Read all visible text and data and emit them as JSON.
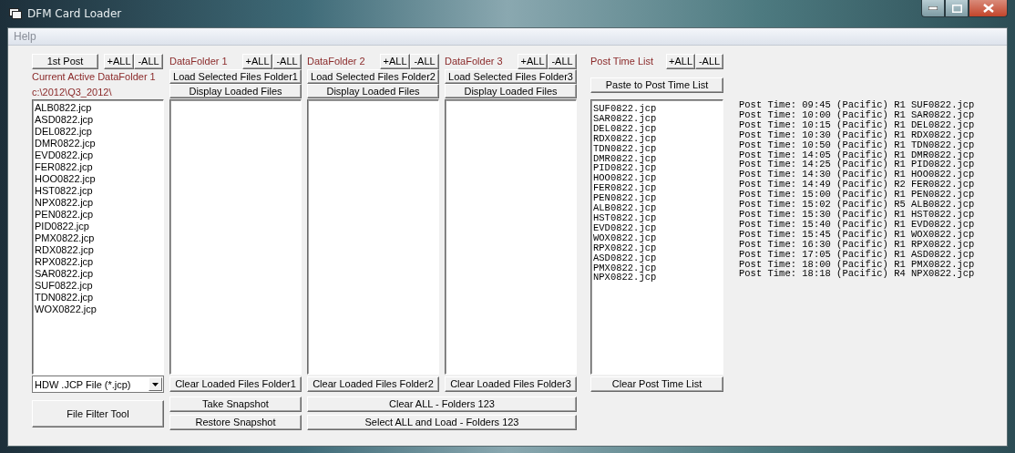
{
  "window": {
    "title": "DFM Card Loader"
  },
  "menu": [
    "Help"
  ],
  "source": {
    "post_button": "1st Post",
    "add_all": "+ALL",
    "remove_all": "-ALL",
    "active_label": "Current Active DataFolder 1",
    "path": "c:\\2012\\Q3_2012\\",
    "files": [
      "ALB0822.jcp",
      "ASD0822.jcp",
      "DEL0822.jcp",
      "DMR0822.jcp",
      "EVD0822.jcp",
      "FER0822.jcp",
      "HOO0822.jcp",
      "HST0822.jcp",
      "NPX0822.jcp",
      "PEN0822.jcp",
      "PID0822.jcp",
      "PMX0822.jcp",
      "RDX0822.jcp",
      "RPX0822.jcp",
      "SAR0822.jcp",
      "SUF0822.jcp",
      "TDN0822.jcp",
      "WOX0822.jcp"
    ],
    "filter": "HDW .JCP File (*.jcp)",
    "filter_tool": "File Filter Tool"
  },
  "folders": [
    {
      "label": "DataFolder 1",
      "add_all": "+ALL",
      "remove_all": "-ALL",
      "load": "Load Selected Files Folder1",
      "display": "Display Loaded Files",
      "clear": "Clear Loaded Files Folder1"
    },
    {
      "label": "DataFolder 2",
      "add_all": "+ALL",
      "remove_all": "-ALL",
      "load": "Load Selected Files Folder2",
      "display": "Display Loaded Files",
      "clear": "Clear Loaded Files Folder2"
    },
    {
      "label": "DataFolder 3",
      "add_all": "+ALL",
      "remove_all": "-ALL",
      "load": "Load Selected Files Folder3",
      "display": "Display Loaded Files",
      "clear": "Clear Loaded Files Folder3"
    }
  ],
  "snapshot": {
    "take": "Take Snapshot",
    "restore": "Restore Snapshot"
  },
  "folder_actions": {
    "clear_all": "Clear ALL - Folders 123",
    "select_all": "Select ALL and Load - Folders 123"
  },
  "post_time": {
    "label": "Post Time List",
    "add_all": "+ALL",
    "remove_all": "-ALL",
    "paste": "Paste to Post Time List",
    "files": [
      "SUF0822.jcp",
      "SAR0822.jcp",
      "DEL0822.jcp",
      "RDX0822.jcp",
      "TDN0822.jcp",
      "DMR0822.jcp",
      "PID0822.jcp",
      "HOO0822.jcp",
      "FER0822.jcp",
      "PEN0822.jcp",
      "ALB0822.jcp",
      "HST0822.jcp",
      "EVD0822.jcp",
      "WOX0822.jcp",
      "RPX0822.jcp",
      "ASD0822.jcp",
      "PMX0822.jcp",
      "NPX0822.jcp"
    ],
    "clear": "Clear Post Time List"
  },
  "output": [
    "Post Time: 09:45 (Pacific) R1 SUF0822.jcp",
    "Post Time: 10:00 (Pacific) R1 SAR0822.jcp",
    "Post Time: 10:15 (Pacific) R1 DEL0822.jcp",
    "Post Time: 10:30 (Pacific) R1 RDX0822.jcp",
    "Post Time: 10:50 (Pacific) R1 TDN0822.jcp",
    "Post Time: 14:05 (Pacific) R1 DMR0822.jcp",
    "Post Time: 14:25 (Pacific) R1 PID0822.jcp",
    "Post Time: 14:30 (Pacific) R1 HOO0822.jcp",
    "Post Time: 14:49 (Pacific) R2 FER0822.jcp",
    "Post Time: 15:00 (Pacific) R1 PEN0822.jcp",
    "Post Time: 15:02 (Pacific) R5 ALB0822.jcp",
    "Post Time: 15:30 (Pacific) R1 HST0822.jcp",
    "Post Time: 15:40 (Pacific) R1 EVD0822.jcp",
    "Post Time: 15:45 (Pacific) R1 WOX0822.jcp",
    "Post Time: 16:30 (Pacific) R1 RPX0822.jcp",
    "Post Time: 17:05 (Pacific) R1 ASD0822.jcp",
    "Post Time: 18:00 (Pacific) R1 PMX0822.jcp",
    "Post Time: 18:18 (Pacific) R4 NPX0822.jcp"
  ]
}
